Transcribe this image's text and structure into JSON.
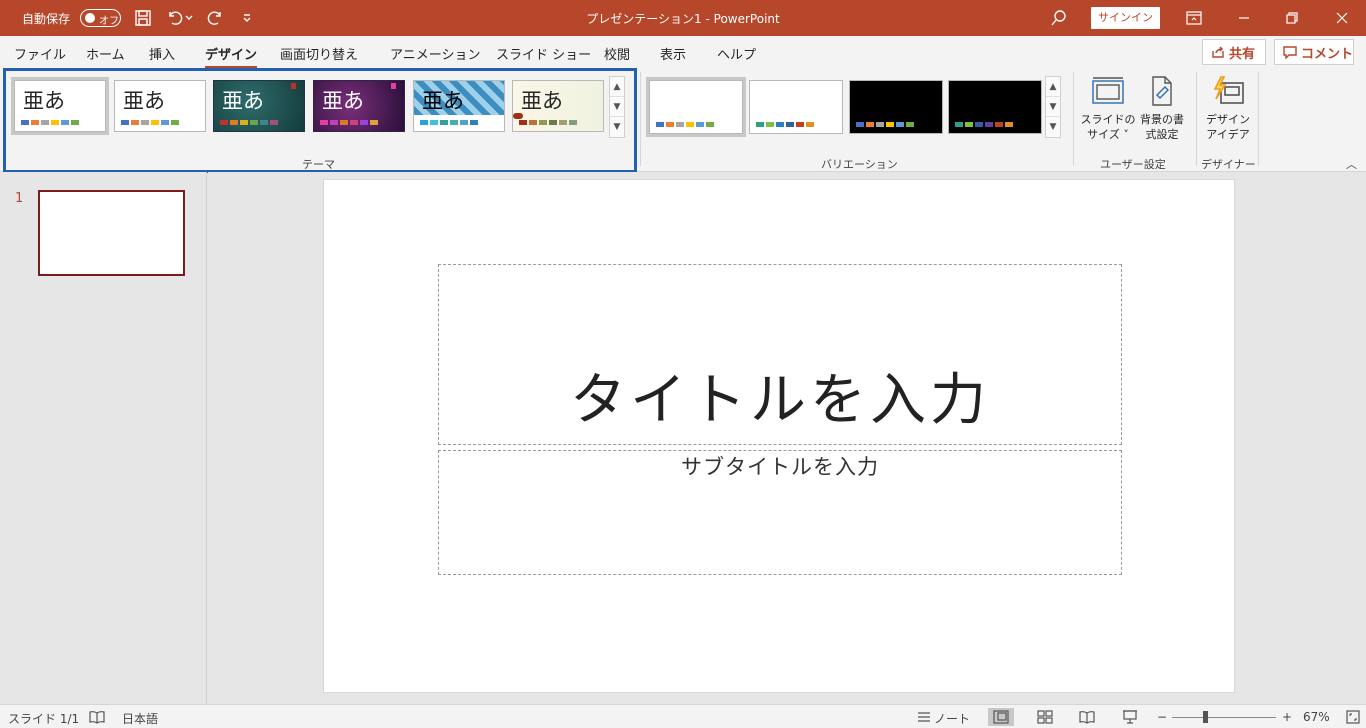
{
  "titlebar": {
    "autosave_label": "自動保存",
    "autosave_toggle": "オフ",
    "doc_title": "プレゼンテーション1  -  PowerPoint",
    "signin": "サインイン"
  },
  "tabs": [
    {
      "label": "ファイル"
    },
    {
      "label": "ホーム"
    },
    {
      "label": "挿入"
    },
    {
      "label": "デザイン"
    },
    {
      "label": "画面切り替え"
    },
    {
      "label": "アニメーション"
    },
    {
      "label": "スライド ショー"
    },
    {
      "label": "校閲"
    },
    {
      "label": "表示"
    },
    {
      "label": "ヘルプ"
    }
  ],
  "share": "共有",
  "comment": "コメント",
  "ribbon": {
    "themes_label": "テーマ",
    "variations_label": "バリエーション",
    "user_settings_label": "ユーザー設定",
    "designer_label": "デザイナー",
    "theme_glyph": "亜あ",
    "slide_size_line1": "スライドの",
    "slide_size_line2": "サイズ ˅",
    "background_line1": "背景の書",
    "background_line2": "式設定",
    "design_ideas_line1": "デザイン",
    "design_ideas_line2": "アイデア"
  },
  "slide_pane": {
    "number": "1"
  },
  "slide": {
    "title_placeholder": "タイトルを入力",
    "subtitle_placeholder": "サブタイトルを入力"
  },
  "statusbar": {
    "slide_count": "スライド 1/1",
    "language": "日本語",
    "notes": "ノート",
    "zoom_minus": "−",
    "zoom_plus": "+",
    "zoom": "67%"
  },
  "colors": {
    "accent": "#b7472a",
    "highlight_box": "#2460b0"
  }
}
